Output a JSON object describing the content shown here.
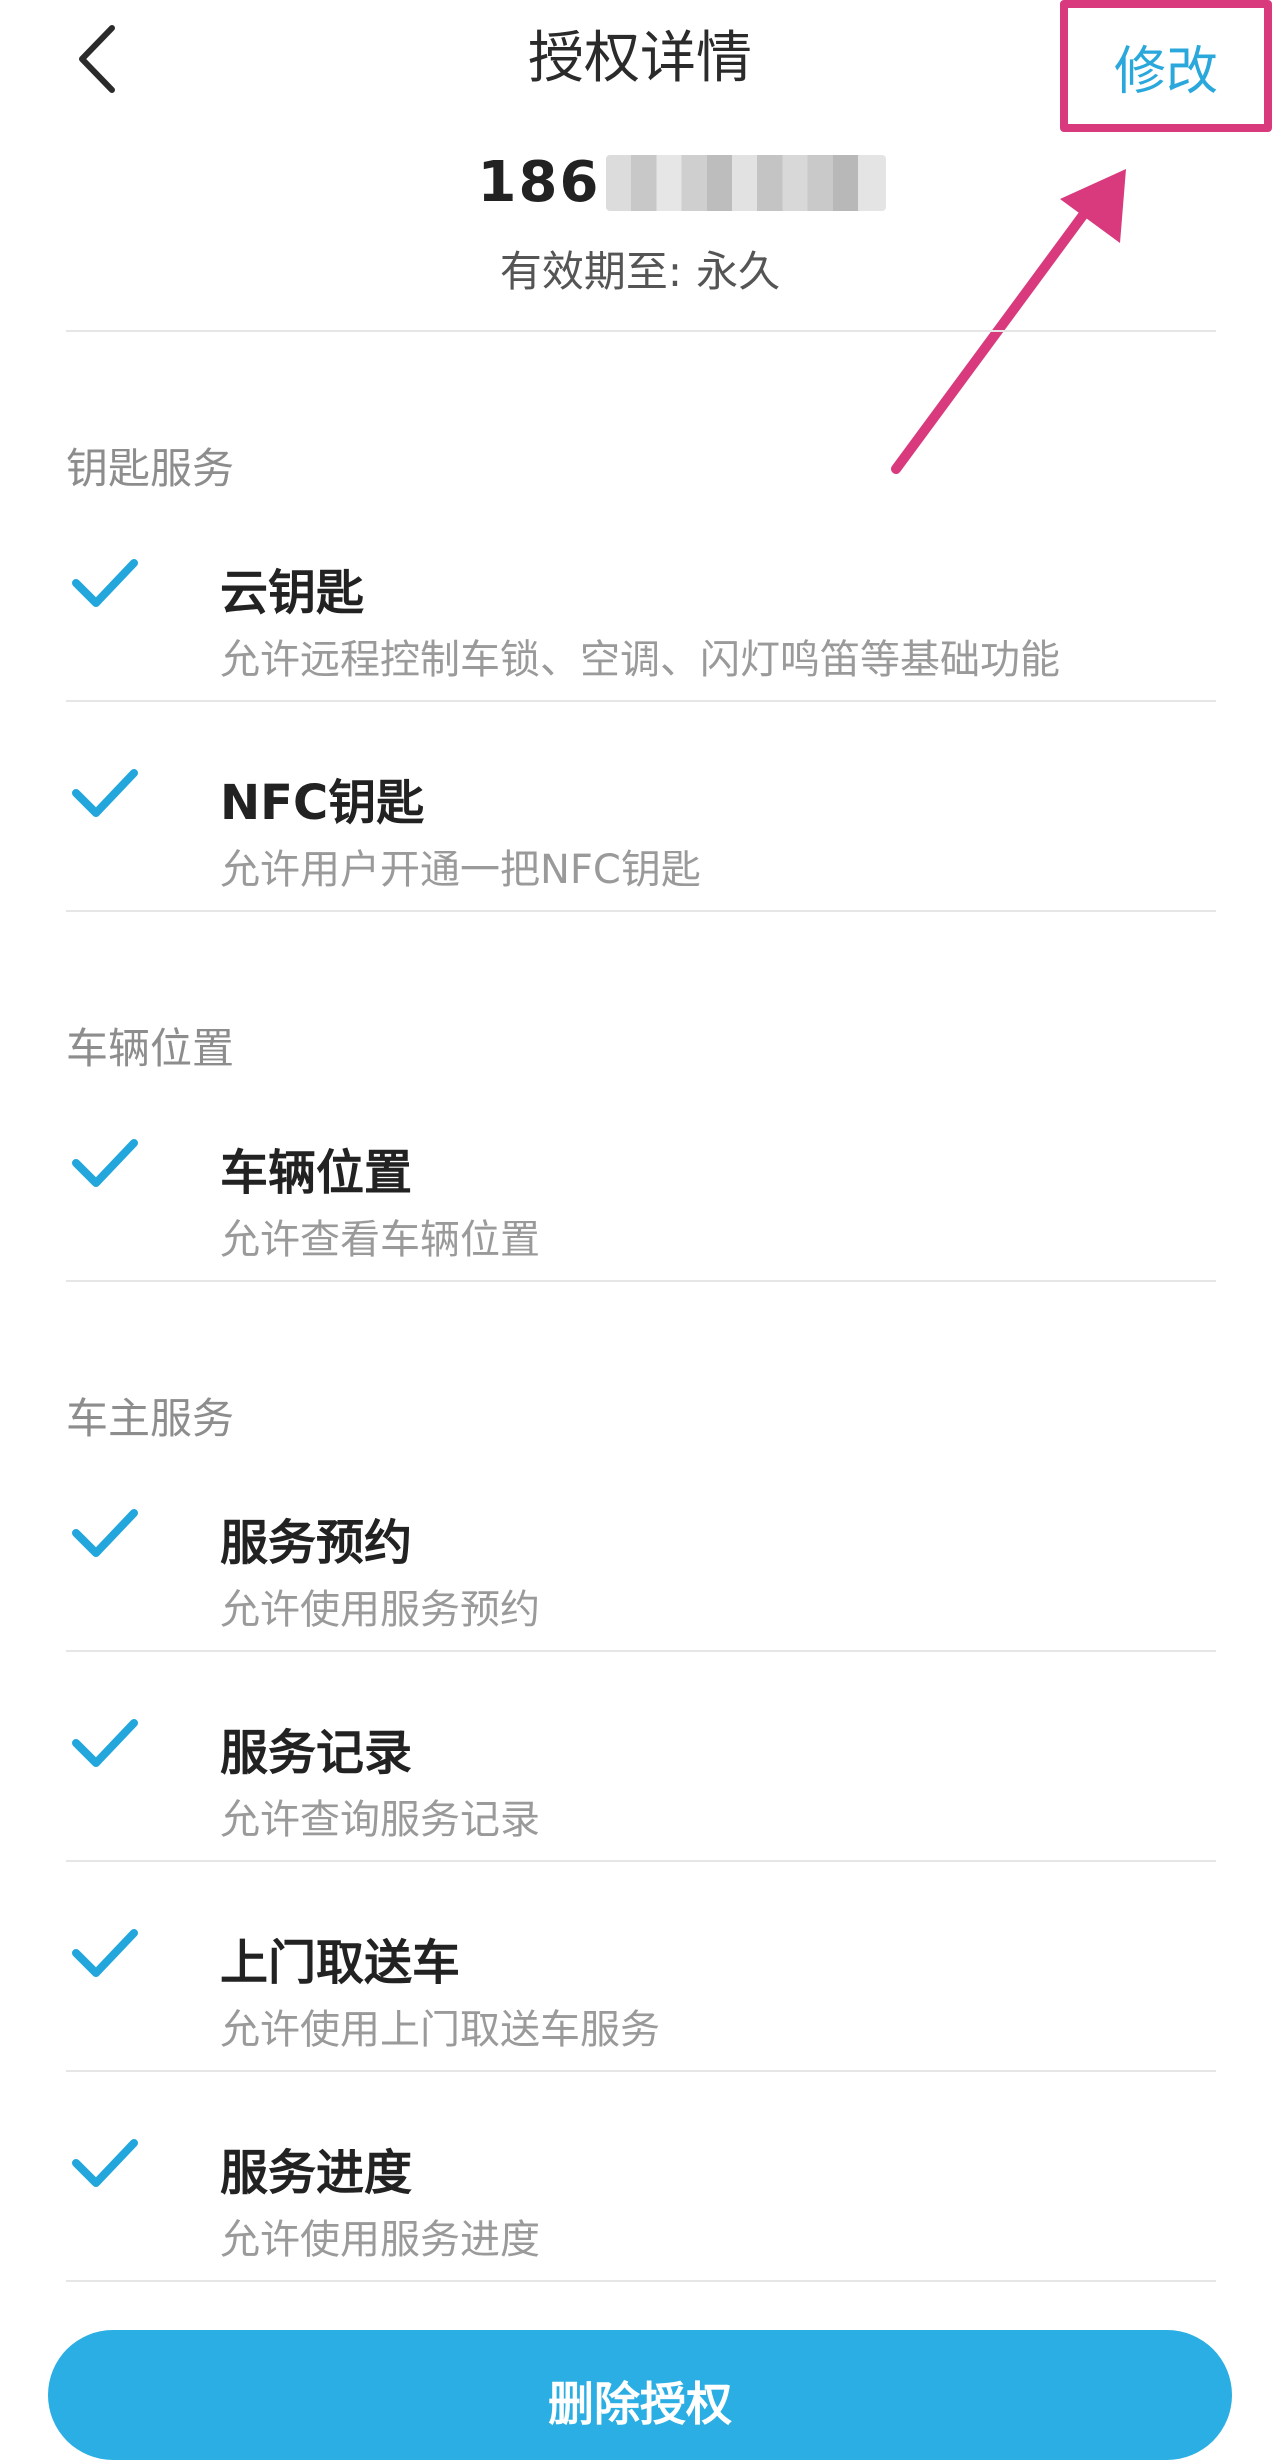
{
  "header": {
    "title": "授权详情",
    "modify_label": "修改",
    "back_icon": "chevron-left-icon"
  },
  "account": {
    "phone_prefix": "186",
    "validity_label": "有效期至:",
    "validity_value": "永久"
  },
  "sections": [
    {
      "title": "钥匙服务",
      "items": [
        {
          "title": "云钥匙",
          "desc": "允许远程控制车锁、空调、闪灯鸣笛等基础功能",
          "checked": true
        },
        {
          "title": "NFC钥匙",
          "desc": "允许用户开通一把NFC钥匙",
          "checked": true
        }
      ]
    },
    {
      "title": "车辆位置",
      "items": [
        {
          "title": "车辆位置",
          "desc": "允许查看车辆位置",
          "checked": true
        }
      ]
    },
    {
      "title": "车主服务",
      "items": [
        {
          "title": "服务预约",
          "desc": "允许使用服务预约",
          "checked": true
        },
        {
          "title": "服务记录",
          "desc": "允许查询服务记录",
          "checked": true
        },
        {
          "title": "上门取送车",
          "desc": "允许使用上门取送车服务",
          "checked": true
        },
        {
          "title": "服务进度",
          "desc": "允许使用服务进度",
          "checked": true
        }
      ]
    }
  ],
  "footer": {
    "delete_label": "删除授权"
  },
  "colors": {
    "accent": "#2aaee3",
    "check": "#22a6dc",
    "annotation": "#d93a7d"
  }
}
